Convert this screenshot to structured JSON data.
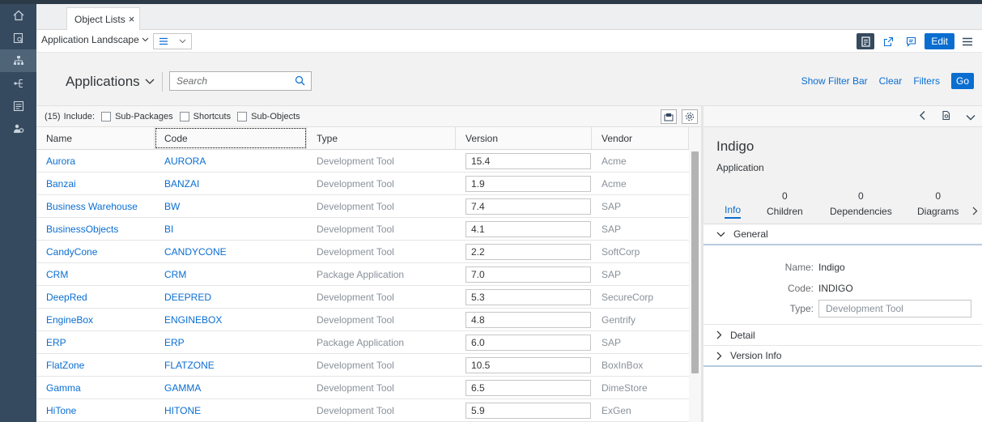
{
  "tab": {
    "label": "Object Lists",
    "close": "×"
  },
  "toolbar": {
    "app_dropdown": "Application Landscape",
    "edit_label": "Edit"
  },
  "filterbar": {
    "title": "Applications",
    "search_placeholder": "Search",
    "show_filter_bar": "Show Filter Bar",
    "clear": "Clear",
    "filters": "Filters",
    "go": "Go"
  },
  "include": {
    "count": "(15)",
    "label": "Include:",
    "sub_packages": "Sub-Packages",
    "shortcuts": "Shortcuts",
    "sub_objects": "Sub-Objects"
  },
  "table": {
    "columns": [
      "Name",
      "Code",
      "Type",
      "Version",
      "Vendor"
    ],
    "rows": [
      {
        "name": "Aurora",
        "code": "AURORA",
        "type": "Development Tool",
        "version": "15.4",
        "vendor": "Acme"
      },
      {
        "name": "Banzai",
        "code": "BANZAI",
        "type": "Development Tool",
        "version": "1.9",
        "vendor": "Acme"
      },
      {
        "name": "Business Warehouse",
        "code": "BW",
        "type": "Development Tool",
        "version": "7.4",
        "vendor": "SAP"
      },
      {
        "name": "BusinessObjects",
        "code": "BI",
        "type": "Development Tool",
        "version": "4.1",
        "vendor": "SAP"
      },
      {
        "name": "CandyCone",
        "code": "CANDYCONE",
        "type": "Development Tool",
        "version": "2.2",
        "vendor": "SoftCorp"
      },
      {
        "name": "CRM",
        "code": "CRM",
        "type": "Package Application",
        "version": "7.0",
        "vendor": "SAP"
      },
      {
        "name": "DeepRed",
        "code": "DEEPRED",
        "type": "Development Tool",
        "version": "5.3",
        "vendor": "SecureCorp"
      },
      {
        "name": "EngineBox",
        "code": "ENGINEBOX",
        "type": "Development Tool",
        "version": "4.8",
        "vendor": "Gentrify"
      },
      {
        "name": "ERP",
        "code": "ERP",
        "type": "Package Application",
        "version": "6.0",
        "vendor": "SAP"
      },
      {
        "name": "FlatZone",
        "code": "FLATZONE",
        "type": "Development Tool",
        "version": "10.5",
        "vendor": "BoxInBox"
      },
      {
        "name": "Gamma",
        "code": "GAMMA",
        "type": "Development Tool",
        "version": "6.5",
        "vendor": "DimeStore"
      },
      {
        "name": "HiTone",
        "code": "HITONE",
        "type": "Development Tool",
        "version": "5.9",
        "vendor": "ExGen"
      }
    ]
  },
  "detail": {
    "title": "Indigo",
    "subtitle": "Application",
    "tabs": {
      "info": "Info",
      "children": {
        "count": "0",
        "label": "Children"
      },
      "dependencies": {
        "count": "0",
        "label": "Dependencies"
      },
      "diagrams": {
        "count": "0",
        "label": "Diagrams"
      }
    },
    "general": "General",
    "fields": {
      "name_label": "Name:",
      "name_value": "Indigo",
      "code_label": "Code:",
      "code_value": "INDIGO",
      "type_label": "Type:",
      "type_value": "Development Tool"
    },
    "detail_section": "Detail",
    "version_section": "Version Info"
  },
  "colors": {
    "accent": "#0a6ed1",
    "shell": "#354a5f"
  }
}
